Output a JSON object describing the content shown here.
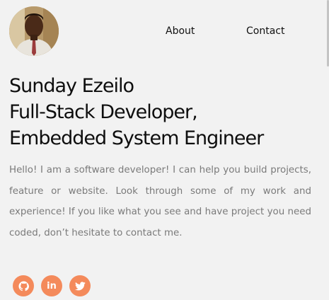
{
  "header": {
    "avatar_icon": "profile-photo",
    "nav": {
      "about_label": "About",
      "contact_label": "Contact"
    }
  },
  "hero": {
    "name": "Sunday Ezeilo",
    "title_line_1": "Full-Stack Developer,",
    "title_line_2": "Embedded System Engineer",
    "intro": "Hello! I am a software developer! I can help you build projects, feature or website. Look through some of my work and experience! If you like what you see and have project you need coded, don’t hesitate to contact me."
  },
  "socials": [
    {
      "icon": "github-icon"
    },
    {
      "icon": "linkedin-icon",
      "glyph": "in"
    },
    {
      "icon": "twitter-icon"
    }
  ],
  "colors": {
    "background": "#f2f2f2",
    "heading": "#0e0e0e",
    "body_text": "#7a7a7a",
    "accent": "#f48a5b"
  }
}
